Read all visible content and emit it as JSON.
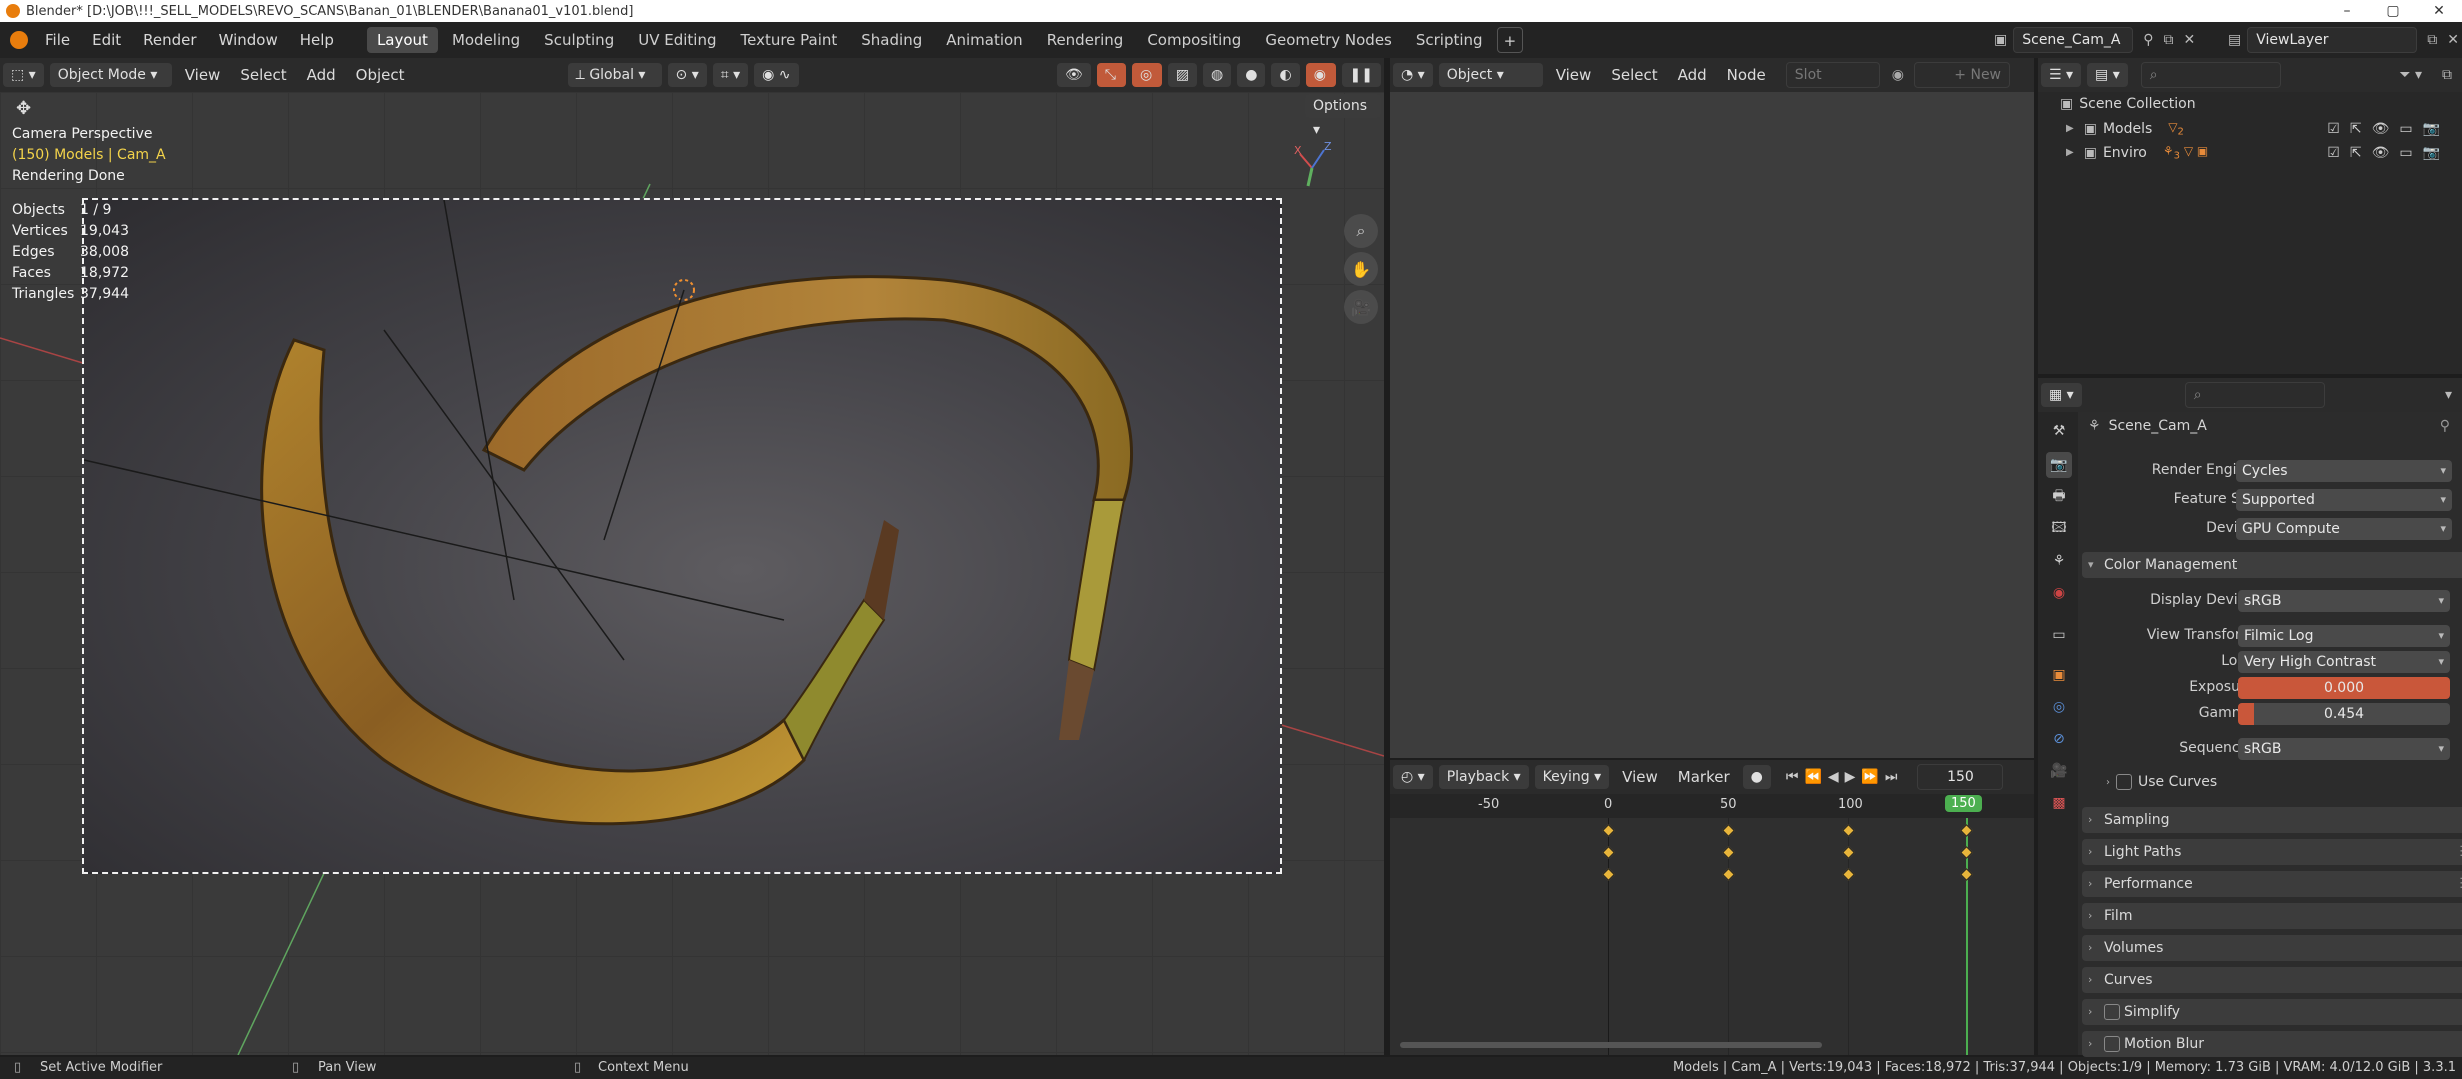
{
  "window": {
    "title": "Blender* [D:\\JOB\\!!!_SELL_MODELS\\REVO_SCANS\\Banan_01\\BLENDER\\Banana01_v101.blend]",
    "controls": [
      "–",
      "▢",
      "✕"
    ]
  },
  "topbar": {
    "menus": [
      "File",
      "Edit",
      "Render",
      "Window",
      "Help"
    ],
    "workspaces": [
      "Layout",
      "Modeling",
      "Sculpting",
      "UV Editing",
      "Texture Paint",
      "Shading",
      "Animation",
      "Rendering",
      "Compositing",
      "Geometry Nodes",
      "Scripting"
    ],
    "active_workspace": "Layout",
    "add_tab": "+",
    "scene": "Scene_Cam_A",
    "view_layer": "ViewLayer"
  },
  "viewport": {
    "mode": "Object Mode",
    "menus": [
      "View",
      "Select",
      "Add",
      "Object"
    ],
    "orientation": "Global",
    "options_label": "Options",
    "overlay": {
      "perspective": "Camera Perspective",
      "object_info": "(150) Models | Cam_A",
      "render_status": "Rendering Done"
    },
    "stats": [
      {
        "label": "Objects",
        "value": "1 / 9"
      },
      {
        "label": "Vertices",
        "value": "19,043"
      },
      {
        "label": "Edges",
        "value": "38,008"
      },
      {
        "label": "Faces",
        "value": "18,972"
      },
      {
        "label": "Triangles",
        "value": "37,944"
      }
    ],
    "gizmo_axes": {
      "x": "X",
      "z": "Z"
    }
  },
  "node_editor": {
    "type": "Object",
    "menus": [
      "View",
      "Select",
      "Add",
      "Node"
    ],
    "slot_placeholder": "Slot",
    "new_label": "New"
  },
  "timeline": {
    "menus": [
      "Playback",
      "Keying",
      "View",
      "Marker"
    ],
    "current_frame": "150",
    "ruler": [
      "-50",
      "0",
      "50",
      "100",
      "150"
    ]
  },
  "outliner": {
    "root": "Scene Collection",
    "collections": [
      {
        "name": "Models",
        "count": "2"
      },
      {
        "name": "Enviro",
        "count": "3"
      }
    ]
  },
  "properties": {
    "context_name": "Scene_Cam_A",
    "render_engine": {
      "label": "Render Engine",
      "value": "Cycles"
    },
    "feature_set": {
      "label": "Feature Set",
      "value": "Supported"
    },
    "device": {
      "label": "Device",
      "value": "GPU Compute"
    },
    "color_management": {
      "title": "Color Management",
      "display_device": {
        "label": "Display Device",
        "value": "sRGB"
      },
      "view_transform": {
        "label": "View Transform",
        "value": "Filmic Log"
      },
      "look": {
        "label": "Look",
        "value": "Very High Contrast"
      },
      "exposure": {
        "label": "Exposure",
        "value": "0.000"
      },
      "gamma": {
        "label": "Gamma",
        "value": "0.454"
      },
      "sequencer": {
        "label": "Sequencer",
        "value": "sRGB"
      },
      "use_curves": "Use Curves"
    },
    "panels": [
      "Sampling",
      "Light Paths",
      "Performance",
      "Film",
      "Volumes",
      "Curves",
      "Simplify",
      "Motion Blur"
    ]
  },
  "statusbar": {
    "hints": [
      "Set Active Modifier",
      "Pan View",
      "Context Menu"
    ],
    "info": "Models | Cam_A | Verts:19,043 | Faces:18,972 | Tris:37,944 | Objects:1/9 | Memory: 1.73 GiB | VRAM: 4.0/12.0 GiB | 3.3.1"
  },
  "colors": {
    "accent": "#e87d0d",
    "active_frame": "#4caf50",
    "keyframe": "#e8b53b",
    "exposure_bar": "#c9573a"
  }
}
